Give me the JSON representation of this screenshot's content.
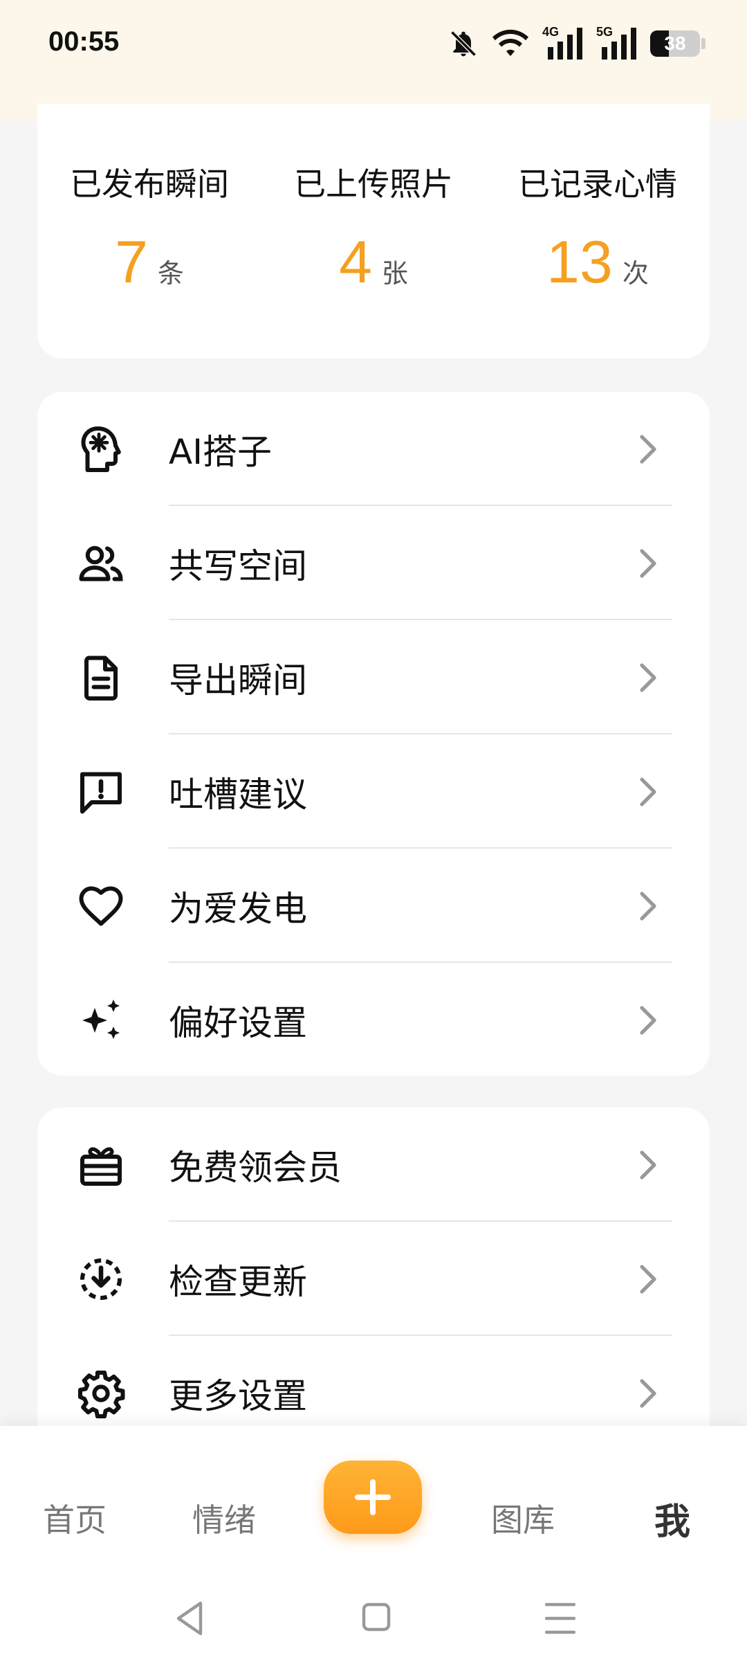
{
  "status_bar": {
    "time": "00:55",
    "battery": 38,
    "network_1": "4G",
    "network_2": "5G",
    "icons": [
      "bell-off-icon",
      "wifi-icon",
      "signal-4g-icon",
      "signal-5g-icon",
      "battery-icon"
    ]
  },
  "stats": [
    {
      "label": "已发布瞬间",
      "value": "7",
      "unit": "条"
    },
    {
      "label": "已上传照片",
      "value": "4",
      "unit": "张"
    },
    {
      "label": "已记录心情",
      "value": "13",
      "unit": "次"
    }
  ],
  "menu_group_1": [
    {
      "label": "AI搭子",
      "icon": "ai-brain-icon"
    },
    {
      "label": "共写空间",
      "icon": "people-icon"
    },
    {
      "label": "导出瞬间",
      "icon": "document-icon"
    },
    {
      "label": "吐槽建议",
      "icon": "feedback-icon"
    },
    {
      "label": "为爱发电",
      "icon": "heart-icon"
    },
    {
      "label": "偏好设置",
      "icon": "sparkle-icon"
    }
  ],
  "menu_group_2": [
    {
      "label": "免费领会员",
      "icon": "gift-icon"
    },
    {
      "label": "检查更新",
      "icon": "download-update-icon"
    },
    {
      "label": "更多设置",
      "icon": "gear-icon"
    }
  ],
  "bottom_nav": {
    "home": "首页",
    "mood": "情绪",
    "add": "+",
    "gallery": "图库",
    "me": "我"
  },
  "colors": {
    "accent": "#f5a020",
    "status_bg": "#fdf6ea",
    "page_bg": "#f5f5f5"
  }
}
